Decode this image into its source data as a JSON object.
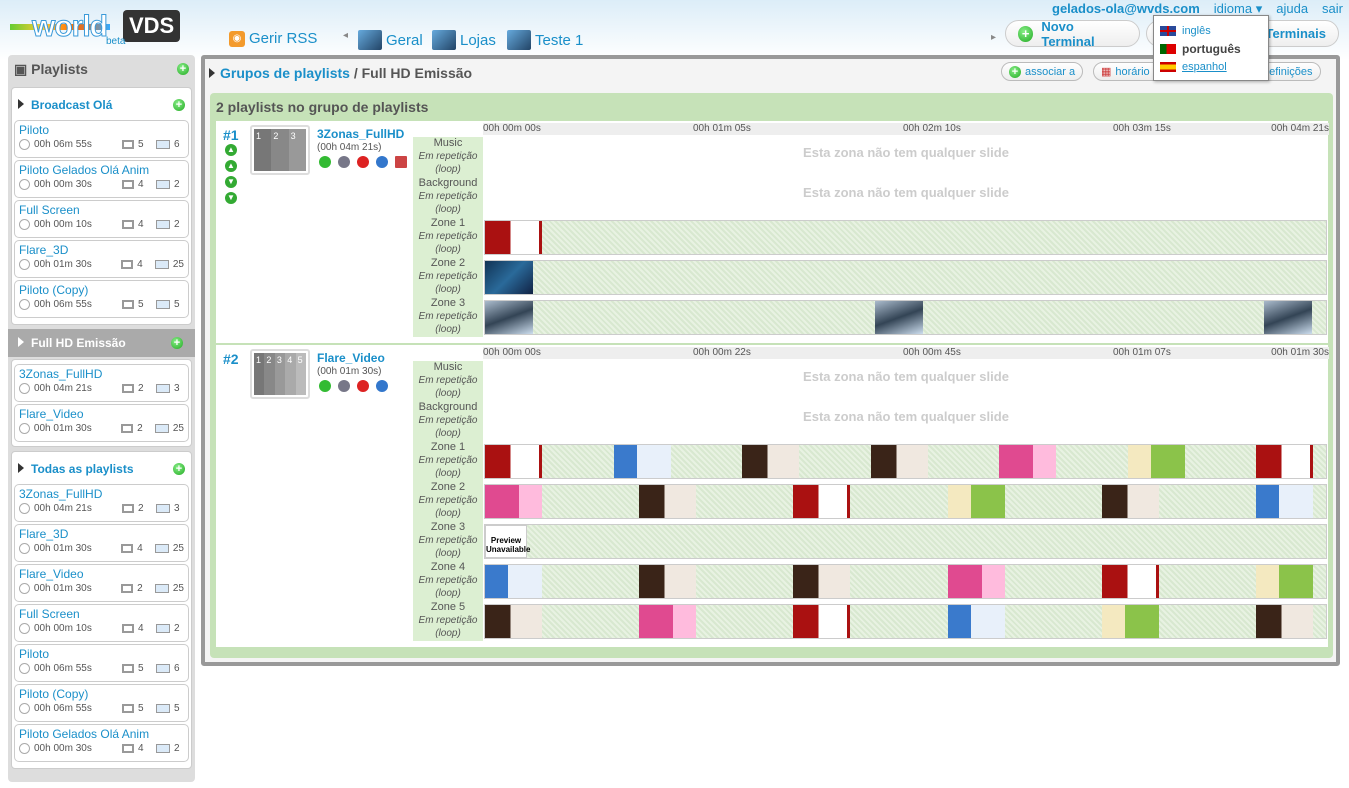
{
  "logo": {
    "text": "world",
    "brand": "VDS",
    "tag": "beta"
  },
  "nav": {
    "rss": "Gerir RSS",
    "groups": [
      "Geral",
      "Lojas",
      "Teste 1"
    ]
  },
  "user": {
    "email": "gelados-ola@wvds.com",
    "language": "idioma ▾",
    "help": "ajuda",
    "logout": "sair"
  },
  "buttons": {
    "new_terminal": "Novo Terminal",
    "terminals": "Terminais"
  },
  "language_menu": [
    {
      "label": "inglês",
      "flag": "uk"
    },
    {
      "label": "português",
      "flag": "pt",
      "selected": true
    },
    {
      "label": "espanhol",
      "flag": "es",
      "hover": true
    }
  ],
  "sidebar": {
    "title": "Playlists",
    "groups": [
      {
        "name": "Broadcast Olá",
        "active": false,
        "items": [
          {
            "name": "Piloto",
            "duration": "00h 06m 55s",
            "terminals": "5",
            "slides": "6"
          },
          {
            "name": "Piloto Gelados Olá Anim",
            "duration": "00h 00m 30s",
            "terminals": "4",
            "slides": "2"
          },
          {
            "name": "Full Screen",
            "duration": "00h 00m 10s",
            "terminals": "4",
            "slides": "2"
          },
          {
            "name": "Flare_3D",
            "duration": "00h 01m 30s",
            "terminals": "4",
            "slides": "25"
          },
          {
            "name": "Piloto (Copy)",
            "duration": "00h 06m 55s",
            "terminals": "5",
            "slides": "5"
          }
        ]
      },
      {
        "name": "Full HD Emissão",
        "active": true,
        "items": [
          {
            "name": "3Zonas_FullHD",
            "duration": "00h 04m 21s",
            "terminals": "2",
            "slides": "3"
          },
          {
            "name": "Flare_Video",
            "duration": "00h 01m 30s",
            "terminals": "2",
            "slides": "25"
          }
        ]
      },
      {
        "name": "Todas as playlists",
        "active": false,
        "items": [
          {
            "name": "3Zonas_FullHD",
            "duration": "00h 04m 21s",
            "terminals": "2",
            "slides": "3"
          },
          {
            "name": "Flare_3D",
            "duration": "00h 01m 30s",
            "terminals": "4",
            "slides": "25"
          },
          {
            "name": "Flare_Video",
            "duration": "00h 01m 30s",
            "terminals": "2",
            "slides": "25"
          },
          {
            "name": "Full Screen",
            "duration": "00h 00m 10s",
            "terminals": "4",
            "slides": "2"
          },
          {
            "name": "Piloto",
            "duration": "00h 06m 55s",
            "terminals": "5",
            "slides": "6"
          },
          {
            "name": "Piloto (Copy)",
            "duration": "00h 06m 55s",
            "terminals": "5",
            "slides": "5"
          },
          {
            "name": "Piloto Gelados Olá Anim",
            "duration": "00h 00m 30s",
            "terminals": "4",
            "slides": "2"
          }
        ]
      }
    ]
  },
  "main": {
    "crumb_link": "Grupos de playlists",
    "crumb_current": " / Full HD Emissão",
    "actions": {
      "associate": "associar a",
      "schedule": "horário",
      "settings": "definições"
    },
    "group_title": "2 playlists no grupo de playlists",
    "empty_text": "Esta zona não tem qualquer slide",
    "loop_text": "Em repetição (loop)",
    "playlists": [
      {
        "index": "#1",
        "name": "3Zonas_FullHD",
        "duration": "(00h 04m 21s)",
        "layout_zones": [
          "1",
          "2",
          "3"
        ],
        "ruler": [
          "00h 00m 00s",
          "00h 01m 05s",
          "00h 02m 10s",
          "00h 03m 15s",
          "00h 04m 21s"
        ],
        "zones": [
          {
            "name": "Music",
            "slides": []
          },
          {
            "name": "Background",
            "slides": []
          },
          {
            "name": "Zone 1",
            "slides": [
              "menu"
            ]
          },
          {
            "name": "Zone 2",
            "slides": [
              "ocean"
            ]
          },
          {
            "name": "Zone 3",
            "slides": [
              "flare",
              "flare",
              "flare"
            ]
          }
        ]
      },
      {
        "index": "#2",
        "name": "Flare_Video",
        "duration": "(00h 01m 30s)",
        "layout_zones": [
          "1",
          "2",
          "3",
          "4",
          "5"
        ],
        "ruler": [
          "00h 00m 00s",
          "00h 00m 22s",
          "00h 00m 45s",
          "00h 01m 07s",
          "00h 01m 30s"
        ],
        "zones": [
          {
            "name": "Music",
            "slides": []
          },
          {
            "name": "Background",
            "slides": []
          },
          {
            "name": "Zone 1",
            "slides": [
              "menu",
              "blue",
              "brown",
              "brown",
              "pink",
              "green",
              "menu"
            ]
          },
          {
            "name": "Zone 2",
            "slides": [
              "pink",
              "brown",
              "menu",
              "green",
              "brown",
              "blue"
            ]
          },
          {
            "name": "Zone 3",
            "slides": [
              "preview"
            ],
            "preview_text": "Preview Unavailable"
          },
          {
            "name": "Zone 4",
            "slides": [
              "blue",
              "brown",
              "brown",
              "pink",
              "menu",
              "green"
            ]
          },
          {
            "name": "Zone 5",
            "slides": [
              "brown",
              "pink",
              "menu",
              "blue",
              "green",
              "brown"
            ]
          }
        ]
      }
    ]
  },
  "colors": {
    "accent": "#1a8fc9",
    "group_bg": "#c6e2b8",
    "active_group": "#aaaaaa"
  }
}
